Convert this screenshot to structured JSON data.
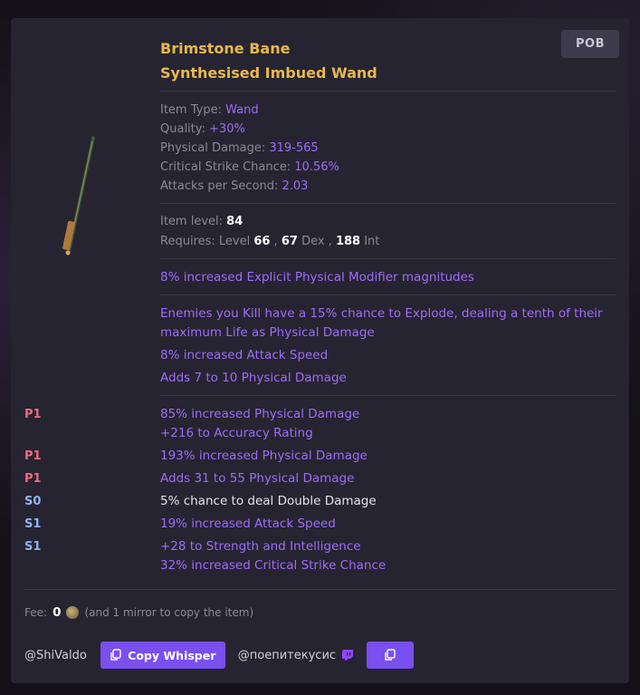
{
  "header": {
    "pob_label": "POB",
    "item_name": "Brimstone Bane",
    "base_type": "Synthesised Imbued Wand"
  },
  "properties": [
    {
      "label": "Item Type: ",
      "value": "Wand"
    },
    {
      "label": "Quality: ",
      "value": "+30%"
    },
    {
      "label": "Physical Damage: ",
      "value": "319-565"
    },
    {
      "label": "Critical Strike Chance: ",
      "value": "10.56%"
    },
    {
      "label": "Attacks per Second: ",
      "value": "2.03"
    }
  ],
  "requirements": {
    "item_level_label": "Item level: ",
    "item_level": "84",
    "requires_label": "Requires: Level ",
    "level": "66",
    "sep1": " , ",
    "dex": "67",
    "dex_label": " Dex , ",
    "int": "188",
    "int_label": " Int"
  },
  "implicit": "8% increased Explicit Physical Modifier magnitudes",
  "synth_mods": [
    "Enemies you Kill have a 15% chance to Explode, dealing a tenth of their",
    "maximum Life as Physical Damage",
    "8% increased Attack Speed",
    "Adds 7 to 10 Physical Damage"
  ],
  "explicit_mods": [
    {
      "tag": "P1",
      "lines": [
        "85% increased Physical Damage",
        "+216 to Accuracy Rating"
      ]
    },
    {
      "tag": "P1",
      "lines": [
        "193% increased Physical Damage"
      ]
    },
    {
      "tag": "P1",
      "lines": [
        "Adds 31 to 55 Physical Damage"
      ]
    },
    {
      "tag": "S0",
      "lines": [
        "5% chance to deal Double Damage"
      ]
    },
    {
      "tag": "S1",
      "lines": [
        "19% increased Attack Speed"
      ]
    },
    {
      "tag": "S1",
      "lines": [
        "+28 to Strength and Intelligence",
        "32% increased Critical Strike Chance"
      ]
    }
  ],
  "fee": {
    "label": "Fee:",
    "amount": "0",
    "note": "(and 1 mirror to copy the item)"
  },
  "contact": {
    "seller": "@ShiValdo",
    "copy_whisper_label": "Copy Whisper",
    "twitch_user": "@поепитекусис"
  },
  "colors": {
    "accent": "#7a4ff0",
    "title": "#e8b84a",
    "mod": "#9d6cf9",
    "prefix_tag": "#ef6b7f",
    "suffix_tag": "#8fb4f0"
  }
}
